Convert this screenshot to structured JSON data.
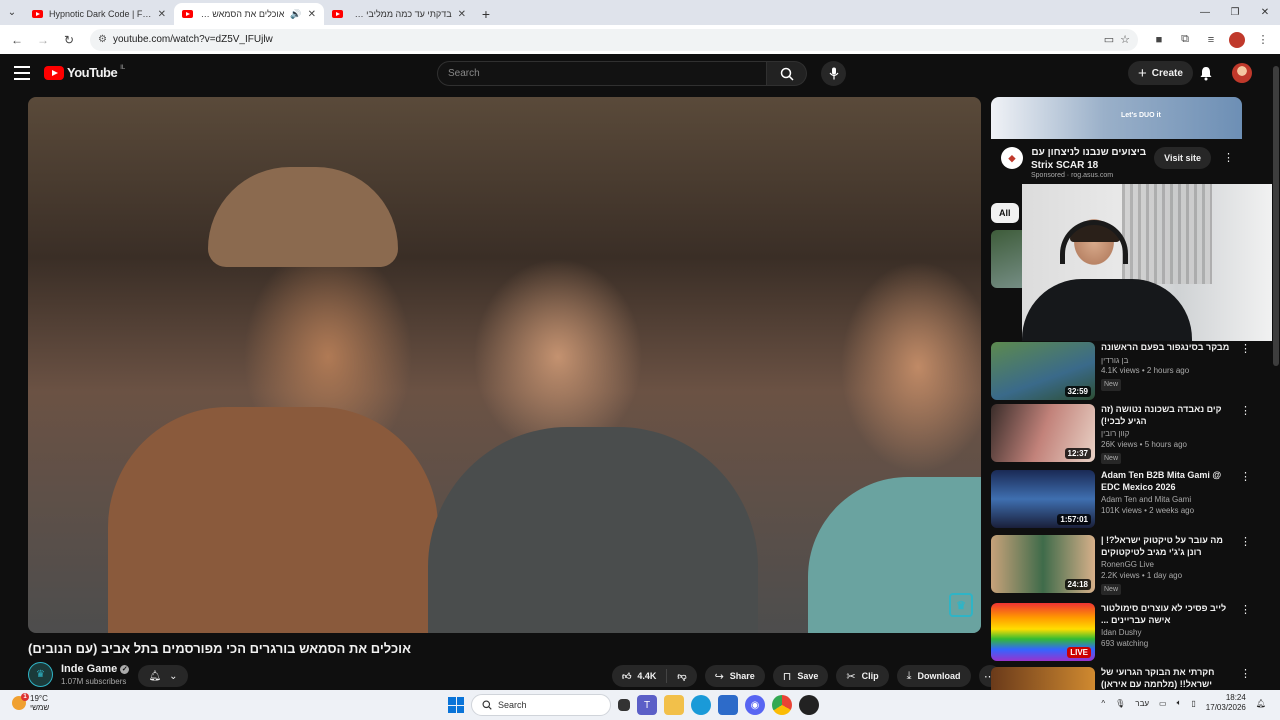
{
  "browser": {
    "tabs": [
      {
        "title": "Hypnotic Dark Code | Futuristic",
        "active": false
      },
      {
        "title": "אוכלים את הסמאש בורגרים",
        "active": true
      },
      {
        "title": "בדקתי עד כמה ממליבי האוכל בי",
        "active": false
      }
    ],
    "url": "youtube.com/watch?v=dZ5V_IFUjlw"
  },
  "youtube": {
    "logo_text": "YouTube",
    "country_code": "IL",
    "search_placeholder": "Search",
    "create_label": "Create"
  },
  "video": {
    "title": "אוכלים את הסמאש בורגרים הכי מפורסמים בתל אביב (עם הנובים)",
    "channel": "Inde Game",
    "subscribers": "1.07M subscribers",
    "likes": "4.4K",
    "actions": {
      "share": "Share",
      "save": "Save",
      "clip": "Clip",
      "download": "Download"
    }
  },
  "ad": {
    "banner_text": "Let's DUO it",
    "headline_he": "ביצועים שנבנו לניצחון עם",
    "headline_en": "Strix SCAR 18",
    "sponsored": "Sponsored · rog.asus.com",
    "visit_label": "Visit site"
  },
  "chips": [
    "All"
  ],
  "recommendations": [
    {
      "title": "מבקר בסינגפור בפעם הראשונה",
      "channel": "בן גורדין",
      "stats": "4.1K views • 2 hours ago",
      "badge": "New",
      "duration": "32:59",
      "live": false,
      "rtl": true
    },
    {
      "title": "קים נאבדה בשכונה נטושה (זה הגיע לבכי!)",
      "channel": "קוון רובין",
      "stats": "26K views • 5 hours ago",
      "badge": "New",
      "duration": "12:37",
      "live": false,
      "rtl": true
    },
    {
      "title": "Adam Ten B2B Mita Gami @ EDC Mexico 2026",
      "channel": "Adam Ten and Mita Gami",
      "stats": "101K views • 2 weeks ago",
      "badge": "",
      "duration": "1:57:01",
      "live": false,
      "rtl": false
    },
    {
      "title": "מה עובר על טיקטוק ישראל?! | רונן ג'ג'י מגיב לטיקטוקים",
      "channel": "RonenGG Live",
      "stats": "2.2K views • 1 day ago",
      "badge": "New",
      "duration": "24:18",
      "live": false,
      "rtl": true
    },
    {
      "title": "לייב פסיכי לא עוצרים סימולטור אישה עבריינים ...",
      "channel": "Idan Dushy",
      "stats": "693 watching",
      "badge": "",
      "duration": "LIVE",
      "live": true,
      "rtl": true
    },
    {
      "title": "חקרתי את הבוקר הגרועי של ישראל!! (מלחמה עם איראן)",
      "channel": "",
      "stats": "",
      "badge": "",
      "duration": "",
      "live": false,
      "rtl": true
    }
  ],
  "taskbar": {
    "weather_temp": "19°C",
    "weather_desc": "שמשי",
    "search_label": "Search",
    "language": "עבר",
    "time": "18:24",
    "date": "17/03/2026"
  }
}
